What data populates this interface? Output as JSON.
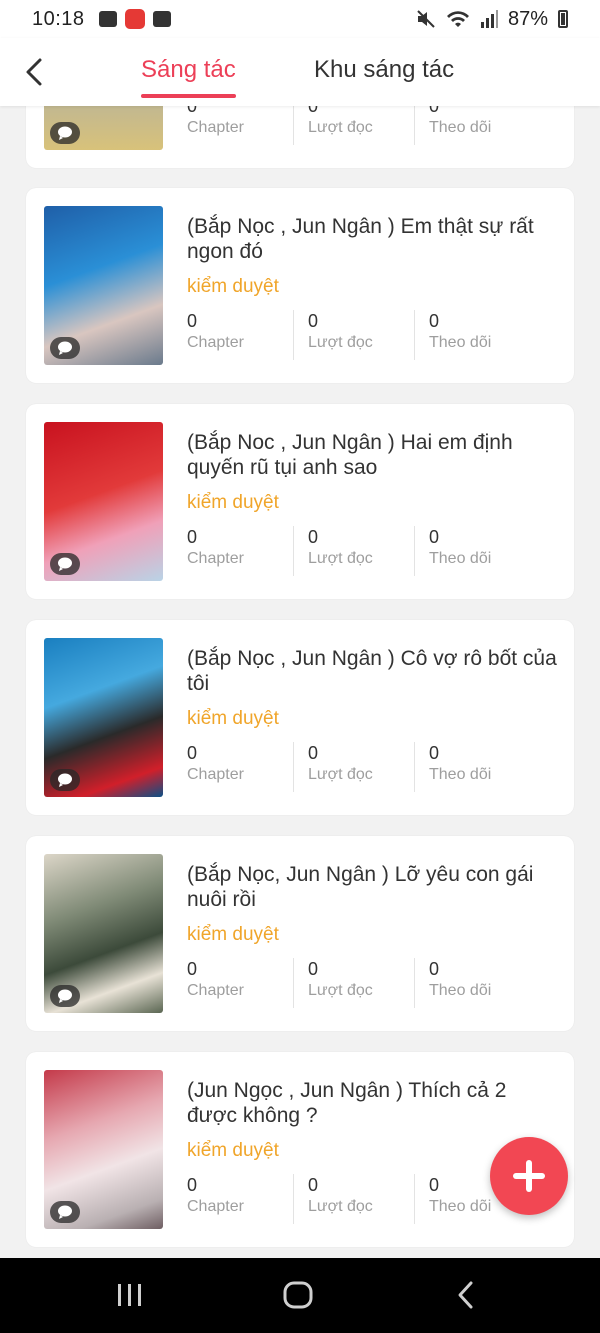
{
  "status_bar": {
    "time": "10:18",
    "battery": "87%"
  },
  "header": {
    "tab_active": "Sáng tác",
    "tab_other": "Khu sáng tác"
  },
  "stat_labels": {
    "chapter": "Chapter",
    "reads": "Lượt đọc",
    "follows": "Theo dõi"
  },
  "top_partial": {
    "chapters": "0",
    "reads": "0",
    "follows": "0"
  },
  "stories": [
    {
      "title": "(Bắp Nọc , Jun Ngân ) Em thật sự rất ngon đó",
      "status": "kiểm duyệt",
      "chapters": "0",
      "reads": "0",
      "follows": "0"
    },
    {
      "title": "(Bắp Noc , Jun Ngân ) Hai em định quyến rũ tụi anh sao",
      "status": "kiểm duyệt",
      "chapters": "0",
      "reads": "0",
      "follows": "0"
    },
    {
      "title": "(Bắp Nọc , Jun Ngân ) Cô vợ rô bốt của tôi",
      "status": "kiểm duyệt",
      "chapters": "0",
      "reads": "0",
      "follows": "0"
    },
    {
      "title": "(Bắp Nọc, Jun Ngân ) Lỡ yêu con gái nuôi rồi",
      "status": "kiểm duyệt",
      "chapters": "0",
      "reads": "0",
      "follows": "0"
    },
    {
      "title": "(Jun Ngọc , Jun Ngân ) Thích cả 2 được không ?",
      "status": "kiểm duyệt",
      "chapters": "0",
      "reads": "0",
      "follows": "0"
    }
  ],
  "colors": {
    "accent": "#ec3f57",
    "status": "#f0a52a",
    "fab": "#f24753"
  }
}
